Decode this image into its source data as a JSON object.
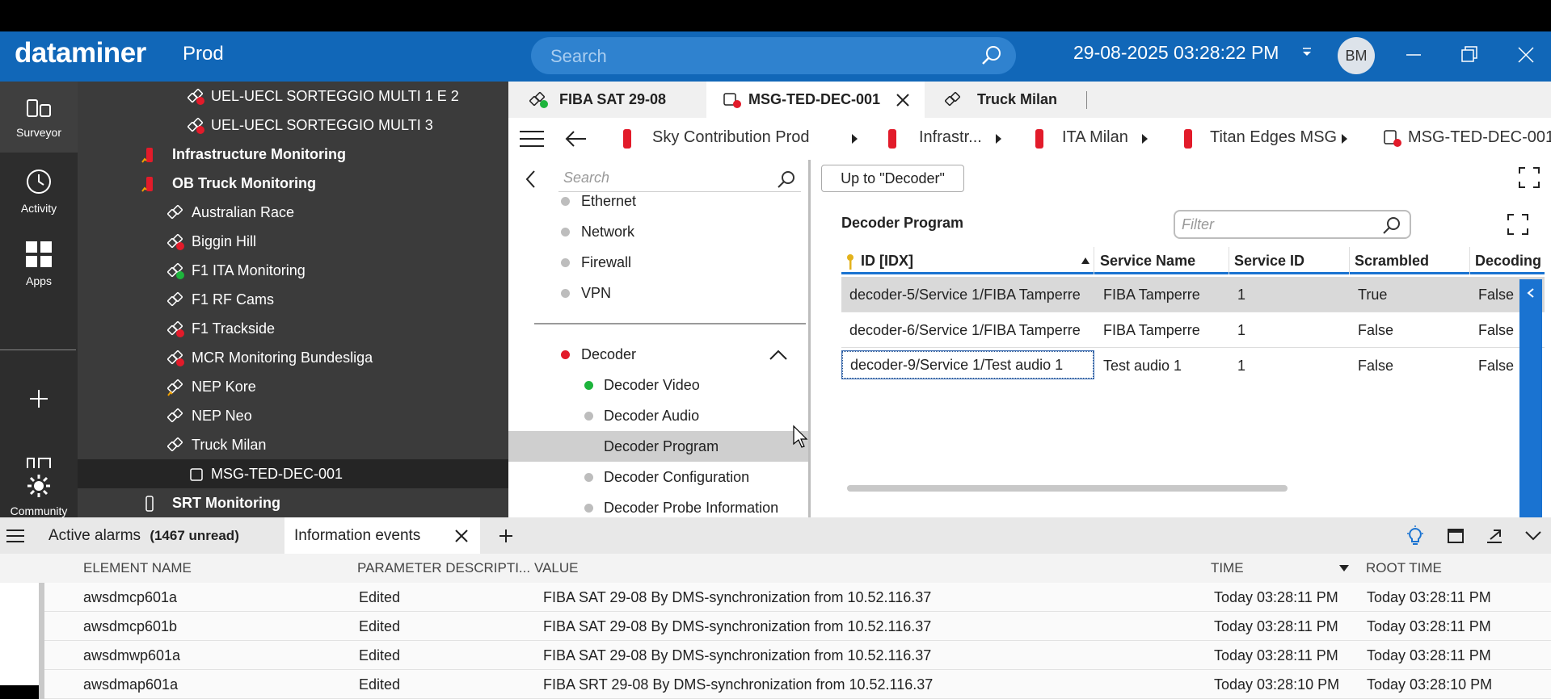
{
  "header": {
    "logo": "dataminer",
    "environment": "Prod",
    "search_placeholder": "Search",
    "datetime": "29-08-2025 03:28:22 PM",
    "avatar_initials": "BM"
  },
  "rail": {
    "items": [
      {
        "label": "Surveyor",
        "icon": "surveyor-icon"
      },
      {
        "label": "Activity",
        "icon": "activity-icon"
      },
      {
        "label": "Apps",
        "icon": "apps-icon"
      },
      {
        "label": "Community",
        "icon": "community-icon"
      }
    ]
  },
  "tree": {
    "items": [
      {
        "label": "UEL-UECL SORTEGGIO MULTI 1 E 2",
        "indent": 2,
        "status": "red"
      },
      {
        "label": "UEL-UECL SORTEGGIO MULTI 3",
        "indent": 2,
        "status": "red"
      },
      {
        "label": "Infrastructure Monitoring",
        "indent": 0,
        "status": "red",
        "bold": true
      },
      {
        "label": "OB Truck Monitoring",
        "indent": 0,
        "status": "red",
        "bold": true
      },
      {
        "label": "Australian Race",
        "indent": 1,
        "status": "none"
      },
      {
        "label": "Biggin Hill",
        "indent": 1,
        "status": "red"
      },
      {
        "label": "F1 ITA Monitoring",
        "indent": 1,
        "status": "green"
      },
      {
        "label": "F1 RF Cams",
        "indent": 1,
        "status": "none"
      },
      {
        "label": "F1 Trackside",
        "indent": 1,
        "status": "red"
      },
      {
        "label": "MCR Monitoring Bundesliga",
        "indent": 1,
        "status": "red"
      },
      {
        "label": "NEP Kore",
        "indent": 1,
        "status": "none"
      },
      {
        "label": "NEP Neo",
        "indent": 1,
        "status": "none"
      },
      {
        "label": "Truck Milan",
        "indent": 1,
        "status": "none"
      },
      {
        "label": "MSG-TED-DEC-001",
        "indent": 2,
        "status": "element",
        "selected": true
      },
      {
        "label": "SRT Monitoring",
        "indent": 0,
        "status": "pin",
        "bold": true
      }
    ]
  },
  "tabs": [
    {
      "label": "FIBA SAT 29-08"
    },
    {
      "label": "MSG-TED-DEC-001",
      "active": true
    },
    {
      "label": "Truck Milan"
    }
  ],
  "breadcrumb": [
    "Sky Contribution Prod",
    "Infrastr...",
    "ITA Milan",
    "Titan Edges MSG",
    "MSG-TED-DEC-001"
  ],
  "nav": {
    "search_placeholder": "Search",
    "items": [
      "Ethernet",
      "Network",
      "Firewall",
      "VPN"
    ],
    "section": "Decoder",
    "sub_items": [
      {
        "label": "Decoder Video",
        "status": "green"
      },
      {
        "label": "Decoder Audio",
        "status": "grey"
      },
      {
        "label": "Decoder Program",
        "status": "none",
        "selected": true
      },
      {
        "label": "Decoder Configuration",
        "status": "grey"
      },
      {
        "label": "Decoder Probe Information",
        "status": "grey"
      }
    ]
  },
  "pane": {
    "up_button": "Up to \"Decoder\"",
    "title": "Decoder Program",
    "filter_placeholder": "Filter",
    "columns": [
      "ID [IDX]",
      "Service Name",
      "Service ID",
      "Scrambled",
      "Decoding"
    ],
    "rows": [
      [
        "decoder-5/Service 1/FIBA Tamperre",
        "FIBA Tamperre",
        "1",
        "True",
        "False"
      ],
      [
        "decoder-6/Service 1/FIBA Tamperre",
        "FIBA Tamperre",
        "1",
        "False",
        "False"
      ],
      [
        "decoder-9/Service 1/Test audio 1",
        "Test audio 1",
        "1",
        "False",
        "False"
      ]
    ]
  },
  "bottom": {
    "tabs": [
      {
        "label": "Active alarms",
        "badge": "(1467 unread)"
      },
      {
        "label": "Information events",
        "active": true
      }
    ],
    "columns": [
      "ELEMENT NAME",
      "PARAMETER DESCRIPTI...",
      "VALUE",
      "TIME",
      "ROOT TIME"
    ],
    "rows": [
      [
        "awsdmcp601a",
        "Edited",
        "FIBA SAT 29-08 By DMS-synchronization from 10.52.116.37",
        "Today 03:28:11 PM",
        "Today 03:28:11 PM"
      ],
      [
        "awsdmcp601b",
        "Edited",
        "FIBA SAT 29-08 By DMS-synchronization from 10.52.116.37",
        "Today 03:28:11 PM",
        "Today 03:28:11 PM"
      ],
      [
        "awsdmwp601a",
        "Edited",
        "FIBA SAT 29-08 By DMS-synchronization from 10.52.116.37",
        "Today 03:28:11 PM",
        "Today 03:28:11 PM"
      ],
      [
        "awsdmap601a",
        "Edited",
        "FIBA SRT 29-08 By DMS-synchronization from 10.52.116.37",
        "Today 03:28:10 PM",
        "Today 03:28:10 PM"
      ]
    ]
  },
  "colors": {
    "header": "#1167b8",
    "accent": "#1a73d1",
    "alarm_red": "#e21b2a",
    "ok_green": "#1db43c"
  }
}
